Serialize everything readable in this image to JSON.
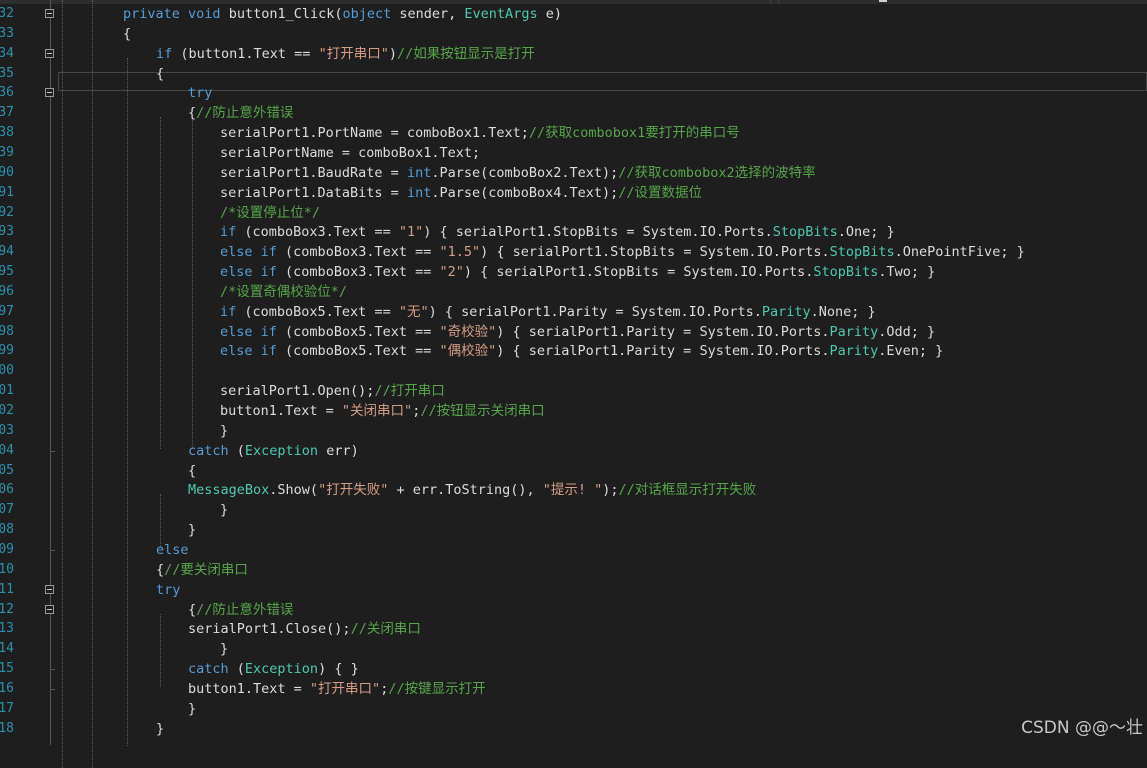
{
  "code_lines": [
    {
      "n": "32",
      "segs": [
        {
          "k": "kw",
          "t": "private"
        },
        {
          "k": "tx",
          "t": " "
        },
        {
          "k": "kw",
          "t": "void"
        },
        {
          "k": "tx",
          "t": " button1_Click("
        },
        {
          "k": "kw",
          "t": "object"
        },
        {
          "k": "tx",
          "t": " sender, "
        },
        {
          "k": "ty",
          "t": "EventArgs"
        },
        {
          "k": "tx",
          "t": " e)"
        }
      ]
    },
    {
      "n": "33",
      "segs": [
        {
          "k": "tx",
          "t": "{"
        }
      ]
    },
    {
      "n": "34",
      "segs": [
        {
          "k": "kw",
          "t": "if"
        },
        {
          "k": "tx",
          "t": " (button1.Text == "
        },
        {
          "k": "st",
          "t": "\"打开串口\""
        },
        {
          "k": "tx",
          "t": ")"
        },
        {
          "k": "cm",
          "t": "//如果按钮显示是打开"
        }
      ]
    },
    {
      "n": "35",
      "segs": [
        {
          "k": "tx",
          "t": "{"
        }
      ]
    },
    {
      "n": "36",
      "segs": [
        {
          "k": "kw",
          "t": "try"
        }
      ]
    },
    {
      "n": "37",
      "segs": [
        {
          "k": "tx",
          "t": "{"
        },
        {
          "k": "cm",
          "t": "//防止意外错误"
        }
      ]
    },
    {
      "n": "38",
      "segs": [
        {
          "k": "tx",
          "t": "serialPort1.PortName = comboBox1.Text;"
        },
        {
          "k": "cm",
          "t": "//获取combobox1要打开的串口号"
        }
      ]
    },
    {
      "n": "39",
      "segs": [
        {
          "k": "tx",
          "t": "serialPortName = comboBox1.Text;"
        }
      ]
    },
    {
      "n": "90",
      "segs": [
        {
          "k": "tx",
          "t": "serialPort1.BaudRate = "
        },
        {
          "k": "kw",
          "t": "int"
        },
        {
          "k": "tx",
          "t": ".Parse(comboBox2.Text);"
        },
        {
          "k": "cm",
          "t": "//获取combobox2选择的波特率"
        }
      ]
    },
    {
      "n": "91",
      "segs": [
        {
          "k": "tx",
          "t": "serialPort1.DataBits = "
        },
        {
          "k": "kw",
          "t": "int"
        },
        {
          "k": "tx",
          "t": ".Parse(comboBox4.Text);"
        },
        {
          "k": "cm",
          "t": "//设置数据位"
        }
      ]
    },
    {
      "n": "92",
      "segs": [
        {
          "k": "cm",
          "t": "/*设置停止位*/"
        }
      ]
    },
    {
      "n": "93",
      "segs": [
        {
          "k": "kw",
          "t": "if"
        },
        {
          "k": "tx",
          "t": " (comboBox3.Text == "
        },
        {
          "k": "st",
          "t": "\"1\""
        },
        {
          "k": "tx",
          "t": ") { serialPort1.StopBits = System.IO.Ports."
        },
        {
          "k": "ty",
          "t": "StopBits"
        },
        {
          "k": "tx",
          "t": ".One; }"
        }
      ]
    },
    {
      "n": "94",
      "segs": [
        {
          "k": "kw",
          "t": "else"
        },
        {
          "k": "tx",
          "t": " "
        },
        {
          "k": "kw",
          "t": "if"
        },
        {
          "k": "tx",
          "t": " (comboBox3.Text == "
        },
        {
          "k": "st",
          "t": "\"1.5\""
        },
        {
          "k": "tx",
          "t": ") { serialPort1.StopBits = System.IO.Ports."
        },
        {
          "k": "ty",
          "t": "StopBits"
        },
        {
          "k": "tx",
          "t": ".OnePointFive; }"
        }
      ]
    },
    {
      "n": "95",
      "segs": [
        {
          "k": "kw",
          "t": "else"
        },
        {
          "k": "tx",
          "t": " "
        },
        {
          "k": "kw",
          "t": "if"
        },
        {
          "k": "tx",
          "t": " (comboBox3.Text == "
        },
        {
          "k": "st",
          "t": "\"2\""
        },
        {
          "k": "tx",
          "t": ") { serialPort1.StopBits = System.IO.Ports."
        },
        {
          "k": "ty",
          "t": "StopBits"
        },
        {
          "k": "tx",
          "t": ".Two; }"
        }
      ]
    },
    {
      "n": "96",
      "segs": [
        {
          "k": "cm",
          "t": "/*设置奇偶校验位*/"
        }
      ]
    },
    {
      "n": "97",
      "segs": [
        {
          "k": "kw",
          "t": "if"
        },
        {
          "k": "tx",
          "t": " (comboBox5.Text == "
        },
        {
          "k": "st",
          "t": "\"无\""
        },
        {
          "k": "tx",
          "t": ") { serialPort1.Parity = System.IO.Ports."
        },
        {
          "k": "ty",
          "t": "Parity"
        },
        {
          "k": "tx",
          "t": ".None; }"
        }
      ]
    },
    {
      "n": "98",
      "segs": [
        {
          "k": "kw",
          "t": "else"
        },
        {
          "k": "tx",
          "t": " "
        },
        {
          "k": "kw",
          "t": "if"
        },
        {
          "k": "tx",
          "t": " (comboBox5.Text == "
        },
        {
          "k": "st",
          "t": "\"奇校验\""
        },
        {
          "k": "tx",
          "t": ") { serialPort1.Parity = System.IO.Ports."
        },
        {
          "k": "ty",
          "t": "Parity"
        },
        {
          "k": "tx",
          "t": ".Odd; }"
        }
      ]
    },
    {
      "n": "99",
      "segs": [
        {
          "k": "kw",
          "t": "else"
        },
        {
          "k": "tx",
          "t": " "
        },
        {
          "k": "kw",
          "t": "if"
        },
        {
          "k": "tx",
          "t": " (comboBox5.Text == "
        },
        {
          "k": "st",
          "t": "\"偶校验\""
        },
        {
          "k": "tx",
          "t": ") { serialPort1.Parity = System.IO.Ports."
        },
        {
          "k": "ty",
          "t": "Parity"
        },
        {
          "k": "tx",
          "t": ".Even; }"
        }
      ]
    },
    {
      "n": "00",
      "segs": []
    },
    {
      "n": "01",
      "segs": [
        {
          "k": "tx",
          "t": "serialPort1.Open();"
        },
        {
          "k": "cm",
          "t": "//打开串口"
        }
      ]
    },
    {
      "n": "02",
      "segs": [
        {
          "k": "tx",
          "t": "button1.Text = "
        },
        {
          "k": "st",
          "t": "\"关闭串口\""
        },
        {
          "k": "tx",
          "t": ";"
        },
        {
          "k": "cm",
          "t": "//按钮显示关闭串口"
        }
      ]
    },
    {
      "n": "03",
      "segs": [
        {
          "k": "tx",
          "t": "}"
        }
      ]
    },
    {
      "n": "04",
      "segs": [
        {
          "k": "kw",
          "t": "catch"
        },
        {
          "k": "tx",
          "t": " ("
        },
        {
          "k": "ty",
          "t": "Exception"
        },
        {
          "k": "tx",
          "t": " err)"
        }
      ]
    },
    {
      "n": "05",
      "segs": [
        {
          "k": "tx",
          "t": "{"
        }
      ]
    },
    {
      "n": "06",
      "segs": [
        {
          "k": "ty",
          "t": "MessageBox"
        },
        {
          "k": "tx",
          "t": ".Show("
        },
        {
          "k": "st",
          "t": "\"打开失败\""
        },
        {
          "k": "tx",
          "t": " + err.ToString(), "
        },
        {
          "k": "st",
          "t": "\"提示! \""
        },
        {
          "k": "tx",
          "t": ");"
        },
        {
          "k": "cm",
          "t": "//对话框显示打开失败"
        }
      ]
    },
    {
      "n": "07",
      "segs": [
        {
          "k": "tx",
          "t": "}"
        }
      ]
    },
    {
      "n": "08",
      "segs": [
        {
          "k": "tx",
          "t": "}"
        }
      ]
    },
    {
      "n": "09",
      "segs": [
        {
          "k": "kw",
          "t": "else"
        }
      ]
    },
    {
      "n": "10",
      "segs": [
        {
          "k": "tx",
          "t": "{"
        },
        {
          "k": "cm",
          "t": "//要关闭串口"
        }
      ]
    },
    {
      "n": "11",
      "segs": [
        {
          "k": "kw",
          "t": "try"
        }
      ]
    },
    {
      "n": "12",
      "segs": [
        {
          "k": "tx",
          "t": "{"
        },
        {
          "k": "cm",
          "t": "//防止意外错误"
        }
      ]
    },
    {
      "n": "13",
      "segs": [
        {
          "k": "tx",
          "t": "serialPort1.Close();"
        },
        {
          "k": "cm",
          "t": "//关闭串口"
        }
      ]
    },
    {
      "n": "14",
      "segs": [
        {
          "k": "tx",
          "t": "}"
        }
      ]
    },
    {
      "n": "15",
      "segs": [
        {
          "k": "kw",
          "t": "catch"
        },
        {
          "k": "tx",
          "t": " ("
        },
        {
          "k": "ty",
          "t": "Exception"
        },
        {
          "k": "tx",
          "t": ") { }"
        }
      ]
    },
    {
      "n": "16",
      "segs": [
        {
          "k": "tx",
          "t": "button1.Text = "
        },
        {
          "k": "st",
          "t": "\"打开串口\""
        },
        {
          "k": "tx",
          "t": ";"
        },
        {
          "k": "cm",
          "t": "//按键显示打开"
        }
      ]
    },
    {
      "n": "17",
      "segs": [
        {
          "k": "tx",
          "t": "}"
        }
      ]
    },
    {
      "n": "18",
      "segs": [
        {
          "k": "tx",
          "t": "}"
        }
      ]
    }
  ],
  "watermark": "CSDN @@～壮",
  "colors": {
    "background": "#1e1e1e",
    "keyword": "#569cd6",
    "type": "#4ec9b0",
    "string": "#d69d85",
    "comment": "#57a64a",
    "text": "#dcdcdc",
    "line_number": "#2b91af"
  }
}
